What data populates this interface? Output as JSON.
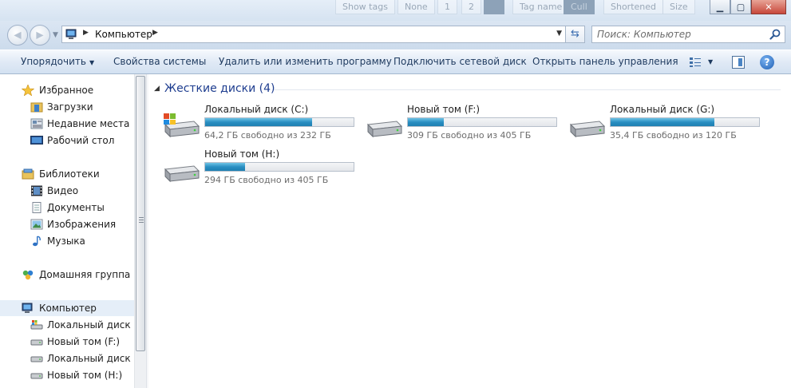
{
  "titlebar": {
    "ghost_tabs": [
      "Show tags",
      "None",
      "1",
      "2",
      "",
      "Tag name",
      "Cull",
      "Shortened",
      "Size"
    ]
  },
  "address": {
    "path": "Компьютер",
    "search_placeholder": "Поиск: Компьютер"
  },
  "toolbar": {
    "organize": "Упорядочить",
    "system_properties": "Свойства системы",
    "uninstall": "Удалить или изменить программу",
    "map_drive": "Подключить сетевой диск",
    "control_panel": "Открыть панель управления"
  },
  "nav": {
    "favorites": "Избранное",
    "downloads": "Загрузки",
    "recent": "Недавние места",
    "desktop": "Рабочий стол",
    "libraries": "Библиотеки",
    "video": "Видео",
    "documents": "Документы",
    "pictures": "Изображения",
    "music": "Музыка",
    "homegroup": "Домашняя группа",
    "computer": "Компьютер",
    "drive_c": "Локальный диск (C:)",
    "drive_f": "Новый том (F:)",
    "drive_g": "Локальный диск (G:)",
    "drive_h": "Новый том (H:)"
  },
  "content": {
    "group_title": "Жесткие диски (4)",
    "drives": [
      {
        "name": "Локальный диск (C:)",
        "free_text": "64,2 ГБ свободно из 232 ГБ",
        "used_fraction": 0.72,
        "system": true
      },
      {
        "name": "Новый том (F:)",
        "free_text": "309 ГБ свободно из 405 ГБ",
        "used_fraction": 0.24,
        "system": false
      },
      {
        "name": "Локальный диск (G:)",
        "free_text": "35,4 ГБ свободно из 120 ГБ",
        "used_fraction": 0.7,
        "system": false
      },
      {
        "name": "Новый том (H:)",
        "free_text": "294 ГБ свободно из 405 ГБ",
        "used_fraction": 0.27,
        "system": false
      }
    ]
  },
  "colors": {
    "bar_fill": "#2a8fc2",
    "header_blue": "#1e3d8f",
    "toolbar_text": "#1e3a5f"
  }
}
